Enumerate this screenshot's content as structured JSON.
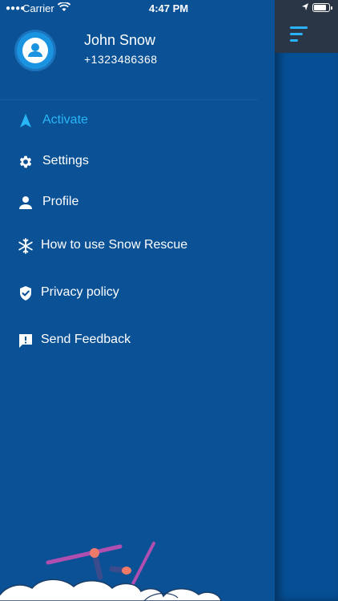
{
  "status_bar": {
    "carrier": "Carrier",
    "time": "4:47 PM",
    "battery_level": 0.85
  },
  "profile": {
    "name": "John Snow",
    "phone": "+1323486368"
  },
  "menu": {
    "items": [
      {
        "label": "Activate",
        "icon": "navigation-arrow-icon",
        "active": true
      },
      {
        "label": "Settings",
        "icon": "gear-icon",
        "active": false
      },
      {
        "label": "Profile",
        "icon": "person-icon",
        "active": false
      },
      {
        "label": "How to use Snow Rescue",
        "icon": "snowflake-icon",
        "active": false
      },
      {
        "label": "Privacy policy",
        "icon": "shield-check-icon",
        "active": false
      },
      {
        "label": "Send Feedback",
        "icon": "feedback-icon",
        "active": false
      }
    ]
  },
  "colors": {
    "drawer_bg": "#0a5196",
    "accent": "#29b6f6",
    "text": "#ffffff",
    "topbar": "#2a3646"
  }
}
